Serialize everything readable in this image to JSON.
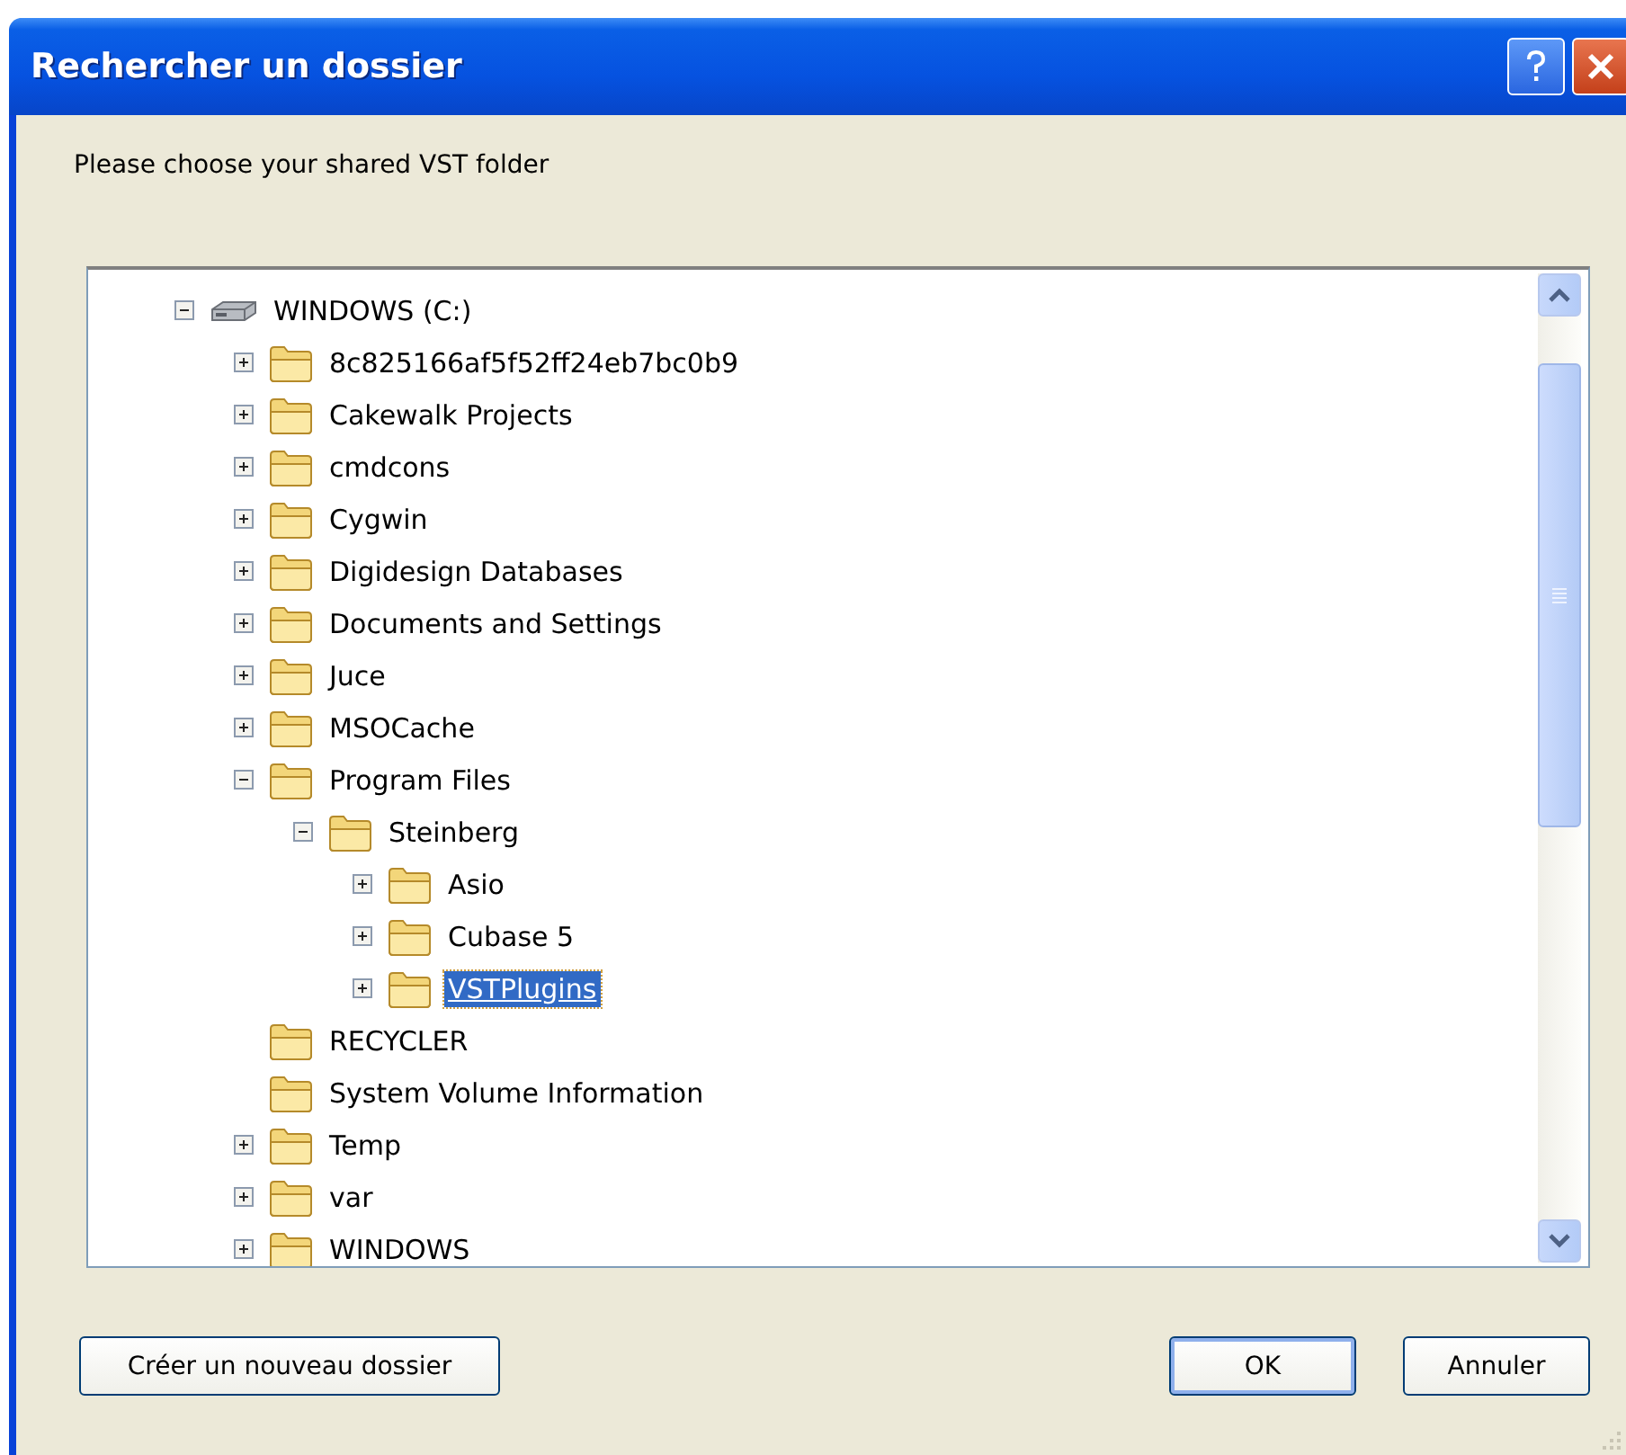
{
  "window": {
    "title": "Rechercher un dossier"
  },
  "prompt": "Please choose your shared VST folder",
  "tree": [
    {
      "label": "WINDOWS (C:)",
      "kind": "drive",
      "expanded": true,
      "selected": false,
      "children": [
        {
          "label": "8c825166af5f52ff24eb7bc0b9",
          "kind": "folder",
          "expanded": false,
          "selected": false
        },
        {
          "label": "Cakewalk Projects",
          "kind": "folder",
          "expanded": false,
          "selected": false
        },
        {
          "label": "cmdcons",
          "kind": "folder",
          "expanded": false,
          "selected": false
        },
        {
          "label": "Cygwin",
          "kind": "folder",
          "expanded": false,
          "selected": false
        },
        {
          "label": "Digidesign Databases",
          "kind": "folder",
          "expanded": false,
          "selected": false
        },
        {
          "label": "Documents and Settings",
          "kind": "folder",
          "expanded": false,
          "selected": false
        },
        {
          "label": "Juce",
          "kind": "folder",
          "expanded": false,
          "selected": false
        },
        {
          "label": "MSOCache",
          "kind": "folder",
          "expanded": false,
          "selected": false
        },
        {
          "label": "Program Files",
          "kind": "folder",
          "expanded": true,
          "selected": false,
          "children": [
            {
              "label": "Steinberg",
              "kind": "folder",
              "expanded": true,
              "selected": false,
              "children": [
                {
                  "label": "Asio",
                  "kind": "folder",
                  "expanded": false,
                  "selected": false
                },
                {
                  "label": "Cubase 5",
                  "kind": "folder",
                  "expanded": false,
                  "selected": false
                },
                {
                  "label": "VSTPlugins",
                  "kind": "folder",
                  "expanded": false,
                  "selected": true
                }
              ]
            }
          ]
        },
        {
          "label": "RECYCLER",
          "kind": "folder",
          "selected": false
        },
        {
          "label": "System Volume Information",
          "kind": "folder",
          "selected": false
        },
        {
          "label": "Temp",
          "kind": "folder",
          "expanded": false,
          "selected": false
        },
        {
          "label": "var",
          "kind": "folder",
          "expanded": false,
          "selected": false
        },
        {
          "label": "WINDOWS",
          "kind": "folder",
          "expanded": false,
          "selected": false
        }
      ]
    }
  ],
  "buttons": [
    {
      "label": "Créer un nouveau dossier",
      "kind": "new-folder"
    },
    {
      "label": "OK",
      "kind": "default"
    },
    {
      "label": "Annuler",
      "kind": "normal"
    }
  ]
}
